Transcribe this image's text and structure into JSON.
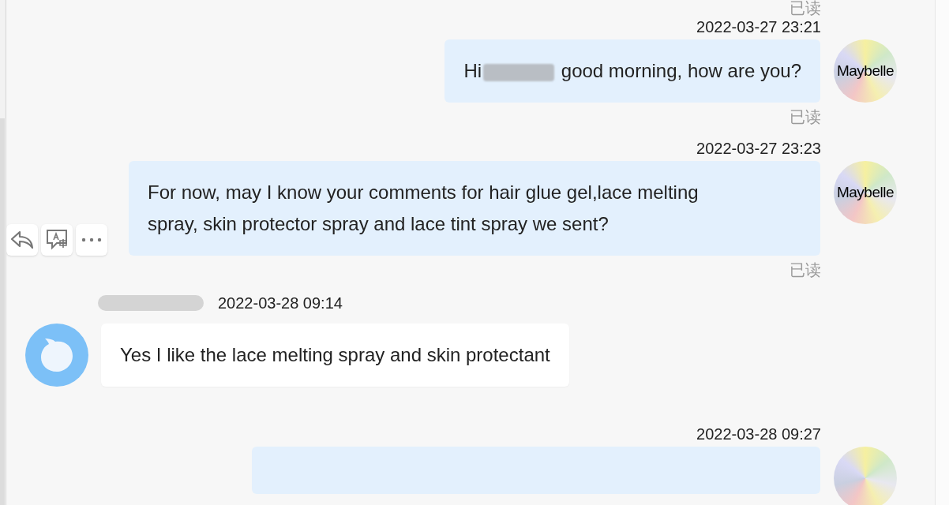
{
  "messages": [
    {
      "kind": "status",
      "text": "已读"
    },
    {
      "kind": "time",
      "text": "2022-03-27 23:21"
    },
    {
      "kind": "outgoing",
      "parts": [
        {
          "text": "Hi"
        },
        {
          "redacted": true
        },
        {
          "text": "good morning, how are you?"
        }
      ],
      "avatar": "Maybelle"
    },
    {
      "kind": "status",
      "text": "已读"
    },
    {
      "kind": "time",
      "text": "2022-03-27 23:23"
    },
    {
      "kind": "outgoing",
      "parts": [
        {
          "text": "For now, may I know your comments for hair glue gel,lace melting spray, skin protector spray and lace tint spray we sent?"
        }
      ],
      "avatar": "Maybelle",
      "actions": true
    },
    {
      "kind": "status",
      "text": "已读"
    },
    {
      "kind": "incoming",
      "sender_redacted": true,
      "time": "2022-03-28 09:14",
      "parts": [
        {
          "text": "Yes I like the lace melting spray and skin protectant"
        }
      ]
    },
    {
      "kind": "time",
      "text": "2022-03-28 09:27"
    },
    {
      "kind": "outgoing"
    }
  ]
}
